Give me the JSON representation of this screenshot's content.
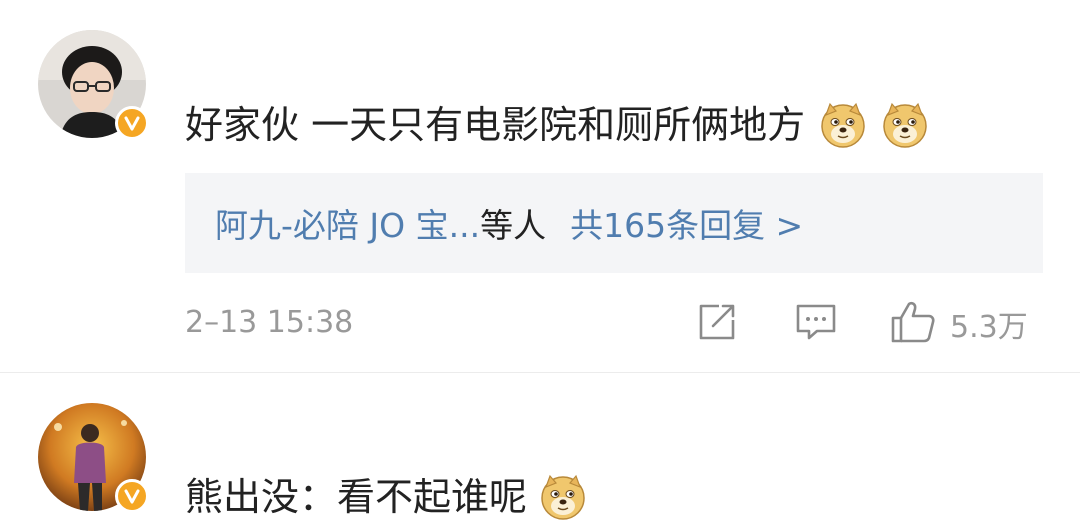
{
  "comments": [
    {
      "text": "好家伙 一天只有电影院和厕所俩地方",
      "emojis": [
        "doge-emoji",
        "doge-emoji"
      ],
      "replies": {
        "users": "阿九-必陪 JO 宝...",
        "suffix": "等人",
        "count_label": "共165条回复 >"
      },
      "time": "2–13 15:38",
      "likes": "5.3万",
      "verified": true
    },
    {
      "text": "熊出没：看不起谁呢",
      "emojis": [
        "doge-emoji"
      ],
      "verified": true
    }
  ],
  "colors": {
    "link": "#507daf",
    "verified": "#f5a623",
    "meta": "#999999"
  }
}
